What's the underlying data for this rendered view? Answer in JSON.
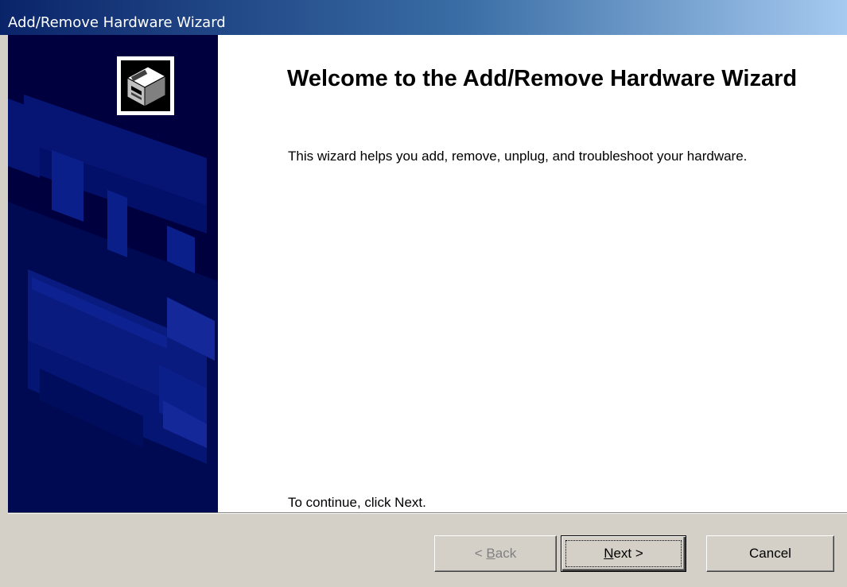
{
  "window": {
    "title": "Add/Remove Hardware Wizard"
  },
  "content": {
    "heading": "Welcome to the Add/Remove Hardware Wizard",
    "description": "This wizard helps you add, remove, unplug, and troubleshoot your hardware.",
    "continue_hint": "To continue, click Next."
  },
  "buttons": {
    "back": {
      "prefix": "< ",
      "mnemonic": "B",
      "rest": "ack",
      "enabled": false
    },
    "next": {
      "mnemonic": "N",
      "rest": "ext",
      "suffix": " >",
      "enabled": true,
      "default": true
    },
    "cancel": {
      "label": "Cancel",
      "enabled": true
    }
  },
  "icons": {
    "wizard_icon": "hardware-drive-icon"
  },
  "colors": {
    "title_gradient_start": "#0a246a",
    "title_gradient_end": "#a6caf0",
    "side_panel": "#00003f",
    "dialog_face": "#d4d0c8"
  }
}
